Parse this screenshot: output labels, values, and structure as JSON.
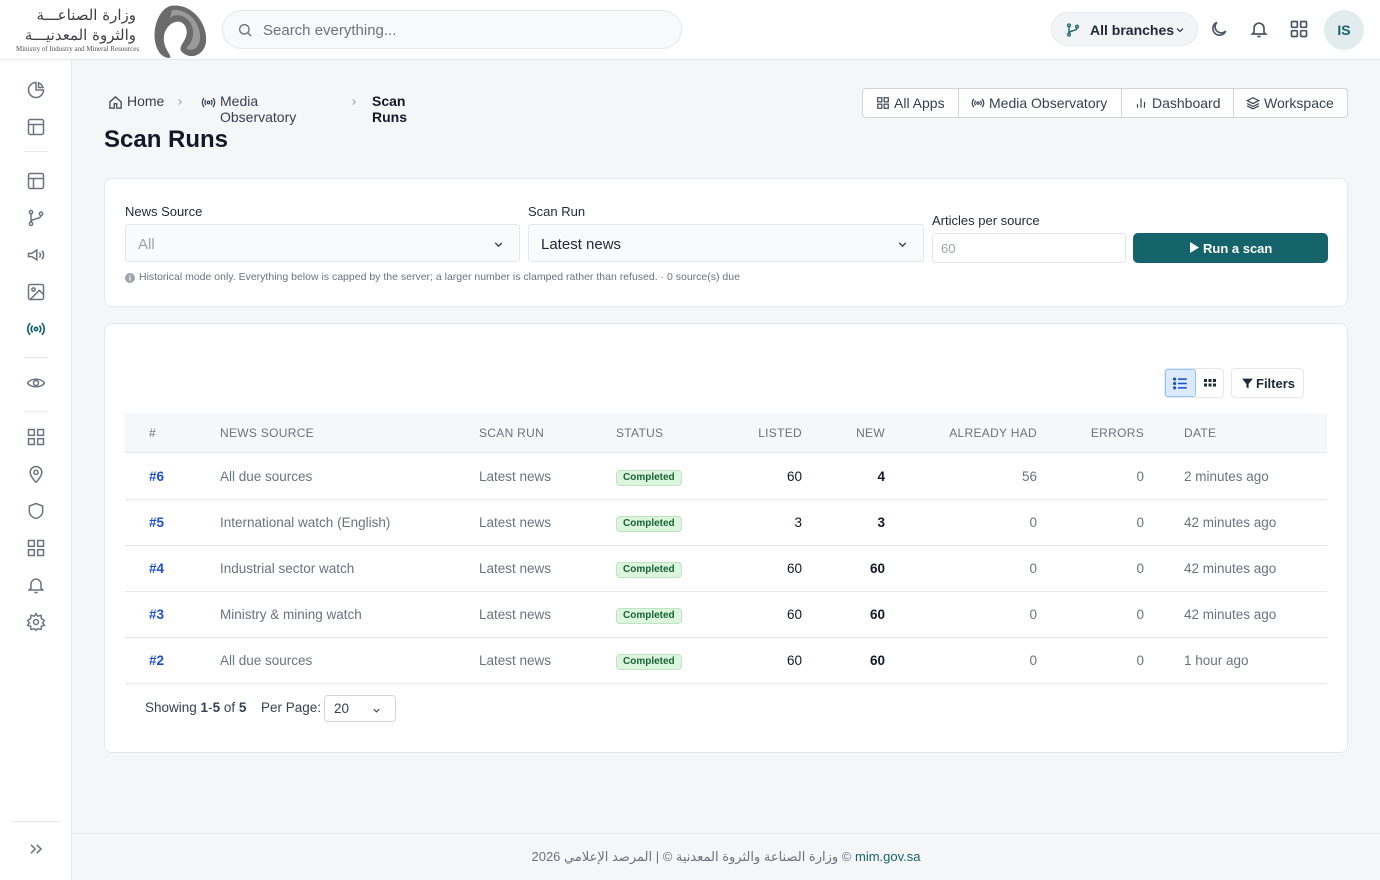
{
  "brand": {
    "arabic_line1": "وزارة الصناعـــة",
    "arabic_line2": "والثروة المعدنيـــة",
    "english_name": "Ministry of Industry and Mineral Resources"
  },
  "search": {
    "placeholder": "Search everything..."
  },
  "header": {
    "branch_label": "All branches",
    "user_initials": "IS"
  },
  "sidebar": {
    "icons": [
      "pie-chart-icon",
      "layout-icon",
      "layout-icon",
      "git-branch-icon",
      "megaphone-icon",
      "image-icon",
      "radio-broadcast-icon",
      "eye-icon",
      "apps-grid-icon",
      "map-pin-icon",
      "shield-icon",
      "apps-grid-icon",
      "bell-icon",
      "settings-icon"
    ],
    "active_icon": "radio-broadcast-icon",
    "expand_icon": "chevrons-right-icon"
  },
  "breadcrumb": {
    "home": "Home",
    "section": "Media Observatory",
    "current": "Scan Runs"
  },
  "page_title": "Scan Runs",
  "app_nav": {
    "all_apps": "All Apps",
    "media_observatory": "Media Observatory",
    "dashboard": "Dashboard",
    "workspace": "Workspace"
  },
  "scan_form": {
    "news_source_label": "News Source",
    "news_source_value": "All",
    "scan_run_label": "Scan Run",
    "scan_run_value": "Latest news",
    "articles_label": "Articles per source",
    "articles_placeholder": "60",
    "run_button": "Run a scan",
    "hint": "Historical mode only. Everything below is capped by the server; a larger number is clamped rather than refused. · 0 source(s) due"
  },
  "table": {
    "filters_label": "Filters",
    "columns": {
      "id": "#",
      "source": "NEWS SOURCE",
      "run": "SCAN RUN",
      "status": "STATUS",
      "listed": "LISTED",
      "new": "NEW",
      "had": "ALREADY HAD",
      "errors": "ERRORS",
      "date": "DATE"
    },
    "rows": [
      {
        "id": "#6",
        "source": "All due sources",
        "run": "Latest news",
        "status": "Completed",
        "listed": "60",
        "new": "4",
        "had": "56",
        "errors": "0",
        "date": "2 minutes ago"
      },
      {
        "id": "#5",
        "source": "International watch (English)",
        "run": "Latest news",
        "status": "Completed",
        "listed": "3",
        "new": "3",
        "had": "0",
        "errors": "0",
        "date": "42 minutes ago"
      },
      {
        "id": "#4",
        "source": "Industrial sector watch",
        "run": "Latest news",
        "status": "Completed",
        "listed": "60",
        "new": "60",
        "had": "0",
        "errors": "0",
        "date": "42 minutes ago"
      },
      {
        "id": "#3",
        "source": "Ministry & mining watch",
        "run": "Latest news",
        "status": "Completed",
        "listed": "60",
        "new": "60",
        "had": "0",
        "errors": "0",
        "date": "42 minutes ago"
      },
      {
        "id": "#2",
        "source": "All due sources",
        "run": "Latest news",
        "status": "Completed",
        "listed": "60",
        "new": "60",
        "had": "0",
        "errors": "0",
        "date": "1 hour ago"
      }
    ]
  },
  "pagination": {
    "showing_prefix": "Showing ",
    "range_start": "1",
    "range_end": "5",
    "of_text": " of ",
    "total": "5",
    "per_page_label": "Per Page:",
    "per_page_value": "20"
  },
  "footer": {
    "text": "2026 وزارة الصناعة والثروة المعدنية  ©  |  المرصد الإعلامي ©",
    "link": "mim.gov.sa"
  },
  "colors": {
    "accent": "#16646b",
    "link": "#1d4ed8",
    "badge_bg": "#dcf5dd",
    "badge_text": "#166534"
  }
}
